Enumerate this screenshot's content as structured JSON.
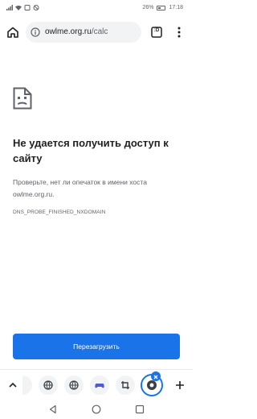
{
  "status_bar": {
    "battery": "26%",
    "time": "17:18"
  },
  "toolbar": {
    "url_domain": "owlme.org.ru",
    "url_path": "/calc",
    "tab_count": ":D"
  },
  "error": {
    "title": "Не удается получить доступ к сайту",
    "description": "Проверьте, нет ли опечаток в имени хоста owlme.org.ru.",
    "code": "DNS_PROBE_FINISHED_NXDOMAIN",
    "reload_label": "Перезагрузить"
  },
  "colors": {
    "accent": "#1a73e8",
    "text_primary": "#202124",
    "text_secondary": "#5f6368"
  }
}
